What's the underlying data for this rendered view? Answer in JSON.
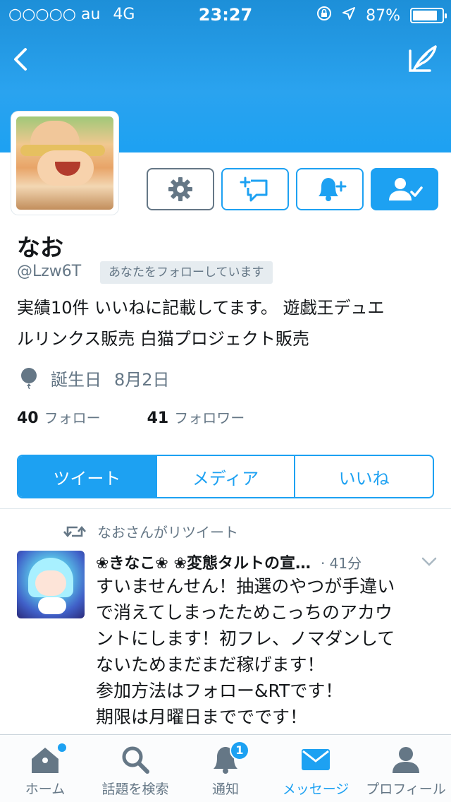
{
  "status_bar": {
    "carrier": "○○○○○ au",
    "network": "4G",
    "time": "23:27",
    "battery": "87%",
    "battery_level": 0.87
  },
  "profile": {
    "name": "なお",
    "handle": "@Lzw6T",
    "follows_you": "あなたをフォローしています",
    "bio_lines": [
      "実績10件 いいねに記載してます。 遊戯王デュエ",
      "ルリンクス販売 白猫プロジェクト販売"
    ],
    "birthday_label": "誕生日",
    "birthday": "8月2日",
    "following_count": "40",
    "following_label": "フォロー",
    "followers_count": "41",
    "followers_label": "フォロワー"
  },
  "tabs": [
    {
      "label": "ツイート",
      "active": true
    },
    {
      "label": "メディア",
      "active": false
    },
    {
      "label": "いいね",
      "active": false
    }
  ],
  "tweet": {
    "retweet_label": "なおさんがリツイート",
    "author": "❀きなこ❀ ❀変態タルトの宣…",
    "time": "· 41分",
    "lines": [
      "すいませんせん！抽選のやつが手違い",
      "で消えてしまったためこっちのアカウ",
      "ントにします！初フレ、ノマダンして",
      "ないためまだまだ稼げます！",
      "参加方法はフォロー&RTです！",
      "期限は月曜日まででです！"
    ]
  },
  "tabbar": {
    "items": [
      {
        "label": "ホーム",
        "icon": "home-icon"
      },
      {
        "label": "話題を検索",
        "icon": "search-icon"
      },
      {
        "label": "通知",
        "icon": "bell-icon",
        "badge": "1"
      },
      {
        "label": "メッセージ",
        "icon": "envelope-icon",
        "active": true
      },
      {
        "label": "プロフィール",
        "icon": "person-icon"
      }
    ]
  },
  "colors": {
    "accent": "#1da1f2",
    "secondary_text": "#657786"
  }
}
